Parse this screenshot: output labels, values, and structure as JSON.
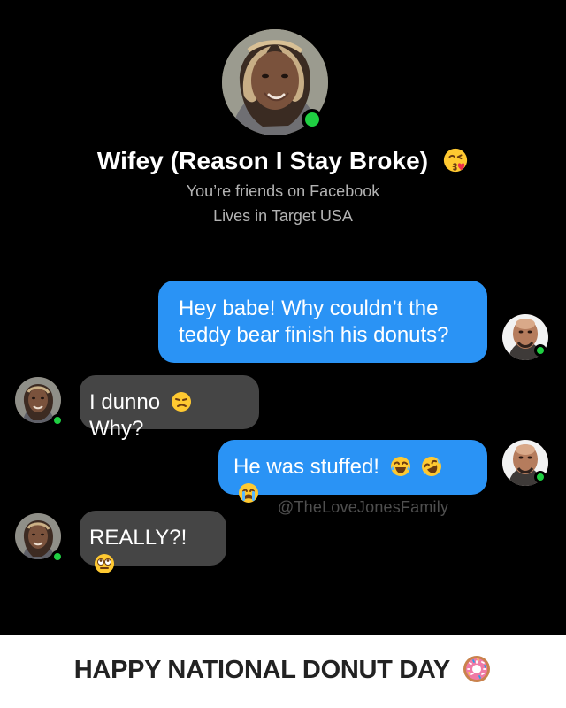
{
  "profile": {
    "name": "Wifey (Reason I Stay Broke)",
    "name_emoji": "kiss-emoji",
    "friends_text": "You’re friends on Facebook",
    "location_text": "Lives in Target USA",
    "status": "online"
  },
  "messages": [
    {
      "side": "right",
      "bubble_color": "#2a93f5",
      "lines": [
        "Hey babe! Why couldn’t the",
        "teddy bear finish his donuts?"
      ],
      "avatar": "male-avatar"
    },
    {
      "side": "left",
      "bubble_color": "#454545",
      "text_before_emoji": "I dunno",
      "emoji": "unamused-face-emoji",
      "text_after_emoji": "Why?",
      "avatar": "female-avatar"
    },
    {
      "side": "right",
      "bubble_color": "#2a93f5",
      "text": "He was stuffed!",
      "emojis": [
        "joy-face-emoji",
        "rofl-face-emoji",
        "crying-face-emoji"
      ],
      "avatar": "male-avatar"
    },
    {
      "side": "left",
      "bubble_color": "#454545",
      "text": "REALLY?!",
      "emoji": "rolling-eyes-emoji",
      "avatar": "female-avatar"
    }
  ],
  "watermark": "@TheLoveJonesFamily",
  "footer": {
    "text": "HAPPY NATIONAL DONUT DAY",
    "icon": "donut-icon"
  },
  "colors": {
    "background": "#000000",
    "footer_background": "#ffffff",
    "online_green": "#1fcf42",
    "blue_bubble": "#2a93f5",
    "gray_bubble": "#454545"
  }
}
